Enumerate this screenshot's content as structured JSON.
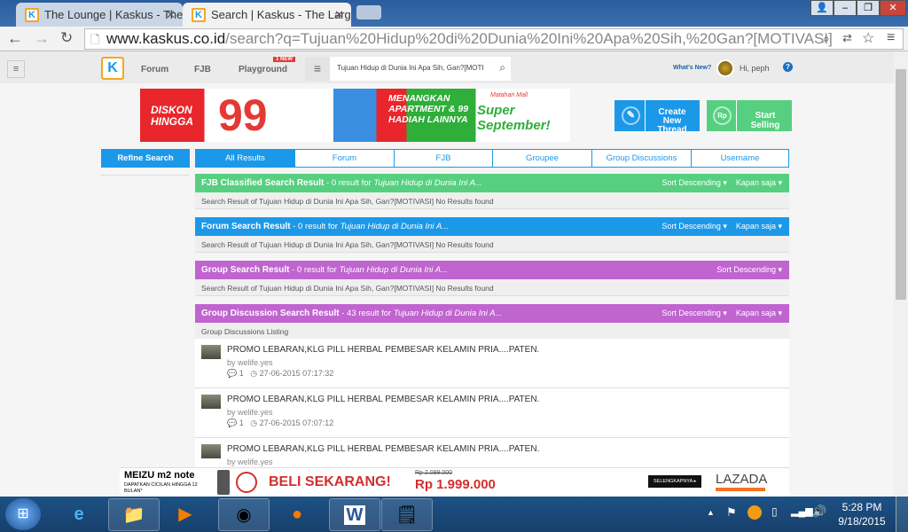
{
  "browser": {
    "tabs": [
      {
        "title": "The Lounge | Kaskus - The",
        "close": "✕"
      },
      {
        "title": "Search | Kaskus - The Larg",
        "close": "✕"
      }
    ],
    "url_host": "www.kaskus.co.id",
    "url_path": "/search?q=Tujuan%20Hidup%20di%20Dunia%20Ini%20Apa%20Sih,%20Gan?[MOTIVASI]"
  },
  "nav": {
    "logo": "K",
    "links": [
      "Forum",
      "FJB",
      "Playground"
    ],
    "new_badge": "1 NEW",
    "search_value": "Tujuan Hidup di Dunia Ini Apa Sih, Gan?[MOTI",
    "whats_new": "What's New?",
    "greeting": "Hi, peph",
    "help": "?"
  },
  "banner": {
    "left_text": "DISKON HINGGA",
    "number": "99",
    "middle_text": "MENANGKAN APARTMENT & 99 HADIAH LAINNYA",
    "brand": "Matahari Mall",
    "tagline": "Super September!"
  },
  "actions": {
    "create": "Create New Thread",
    "sell": "Start Selling",
    "sell_icon": "Rp"
  },
  "refine": "Refine Search",
  "tabs": [
    "All Results",
    "Forum",
    "FJB",
    "Groupee",
    "Group Discussions",
    "Username"
  ],
  "sections": [
    {
      "title": "FJB Classified Search Result",
      "count": " - 0 result for ",
      "query": "Tujuan Hidup di Dunia Ini A...",
      "sort": "Sort Descending",
      "time": "Kapan saja",
      "sub": "Search Result of Tujuan Hidup di Dunia Ini Apa Sih, Gan?[MOTIVASI] No Results found",
      "color": "#57cf80"
    },
    {
      "title": "Forum Search Result",
      "count": " - 0 result for ",
      "query": "Tujuan Hidup di Dunia Ini A...",
      "sort": "Sort Descending",
      "time": "Kapan saja",
      "sub": "Search Result of Tujuan Hidup di Dunia Ini Apa Sih, Gan?[MOTIVASI] No Results found",
      "color": "#1c98e8"
    },
    {
      "title": "Group Search Result",
      "count": " - 0 result for ",
      "query": "Tujuan Hidup di Dunia Ini A...",
      "sort": "Sort Descending",
      "sub": "Search Result of Tujuan Hidup di Dunia Ini Apa Sih, Gan?[MOTIVASI] No Results found",
      "color": "#c064d0"
    },
    {
      "title": "Group Discussion Search Result",
      "count": " - 43 result for ",
      "query": "Tujuan Hidup di Dunia Ini A...",
      "sort": "Sort Descending",
      "time": "Kapan saja",
      "sub": "Group Discussions Listing",
      "color": "#c064d0"
    }
  ],
  "discussions": [
    {
      "title": "PROMO LEBARAN,KLG PILL HERBAL PEMBESAR KELAMIN PRIA....PATEN.",
      "by": "by welife.yes",
      "replies": "1",
      "date": "27-06-2015 07:17:32"
    },
    {
      "title": "PROMO LEBARAN,KLG PILL HERBAL PEMBESAR KELAMIN PRIA....PATEN.",
      "by": "by welife.yes",
      "replies": "1",
      "date": "27-06-2015 07:07:12"
    },
    {
      "title": "PROMO LEBARAN,KLG PILL HERBAL PEMBESAR KELAMIN PRIA....PATEN.",
      "by": "by welife.yes"
    }
  ],
  "ad": {
    "brand": "MEIZU m2 note",
    "sub": "DAPATKAN CICILAN HINGGA 12 BULAN*",
    "cta": "BELI SEKARANG!",
    "old_price": "Rp 2.099.000",
    "price": "Rp 1.999.000",
    "more": "SELENGKAPNYA ▸",
    "shop": "LAZADA"
  },
  "taskbar": {
    "time": "5:28 PM",
    "date": "9/18/2015"
  }
}
